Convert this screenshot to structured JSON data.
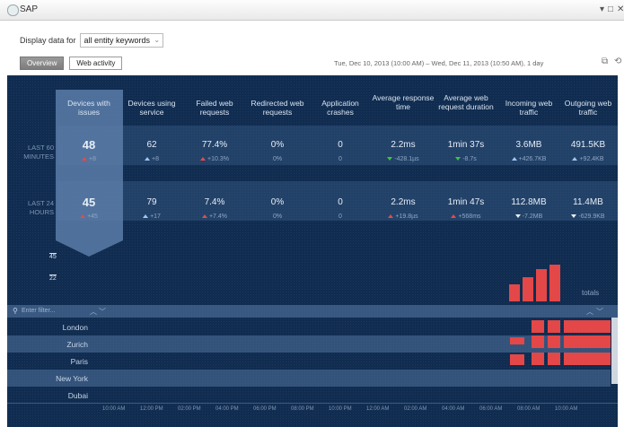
{
  "window": {
    "title": "SAP",
    "controls": {
      "minimize": "▾",
      "maximize": "□",
      "close": "✕"
    }
  },
  "display": {
    "label": "Display data for",
    "select_value": "all entity keywords"
  },
  "tabs": [
    {
      "label": "Overview"
    },
    {
      "label": "Web activity"
    }
  ],
  "date_range": "Tue, Dec 10, 2013 (10:00 AM) – Wed, Dec 11, 2013 (10:50 AM), 1 day",
  "metrics": {
    "columns": [
      {
        "header": "Devices with issues"
      },
      {
        "header": "Devices using service"
      },
      {
        "header": "Failed web requests"
      },
      {
        "header": "Redirected web requests"
      },
      {
        "header": "Application crashes"
      },
      {
        "header": "Average response time"
      },
      {
        "header": "Average web request duration"
      },
      {
        "header": "Incoming web traffic"
      },
      {
        "header": "Outgoing web traffic"
      }
    ],
    "rows": [
      {
        "label": "LAST 60 MINUTES",
        "cells": [
          {
            "value": "48",
            "delta": "+8",
            "trend": "up-red"
          },
          {
            "value": "62",
            "delta": "+8",
            "trend": "up-blue"
          },
          {
            "value": "77.4%",
            "delta": "+10.3%",
            "trend": "up-red"
          },
          {
            "value": "0%",
            "delta": "0%",
            "trend": "none"
          },
          {
            "value": "0",
            "delta": "0",
            "trend": "none"
          },
          {
            "value": "2.2ms",
            "delta": "-428.1µs",
            "trend": "down-green"
          },
          {
            "value": "1min 37s",
            "delta": "-8.7s",
            "trend": "down-green"
          },
          {
            "value": "3.6MB",
            "delta": "+426.7KB",
            "trend": "up-blue"
          },
          {
            "value": "491.5KB",
            "delta": "+92.4KB",
            "trend": "up-blue"
          }
        ]
      },
      {
        "label": "LAST 24 HOURS",
        "cells": [
          {
            "value": "45",
            "delta": "+45",
            "trend": "up-red"
          },
          {
            "value": "79",
            "delta": "+17",
            "trend": "up-blue"
          },
          {
            "value": "7.4%",
            "delta": "+7.4%",
            "trend": "up-red"
          },
          {
            "value": "0%",
            "delta": "0%",
            "trend": "none"
          },
          {
            "value": "0",
            "delta": "0",
            "trend": "none"
          },
          {
            "value": "2.2ms",
            "delta": "+19.8µs",
            "trend": "up-red"
          },
          {
            "value": "1min 47s",
            "delta": "+568ms",
            "trend": "up-red"
          },
          {
            "value": "112.8MB",
            "delta": "-7.2MB",
            "trend": "down-white"
          },
          {
            "value": "11.4MB",
            "delta": "-629.9KB",
            "trend": "down-white"
          }
        ]
      }
    ]
  },
  "chart": {
    "scale_labels": [
      "45",
      "22"
    ],
    "totals_label": "totals",
    "totals_values": [
      22,
      30,
      40,
      45
    ],
    "filter_placeholder": "Enter filter...",
    "cities": [
      "London",
      "Zurich",
      "Paris",
      "New York",
      "Dubai"
    ],
    "time_ticks": [
      "10:00 AM",
      "12:00 PM",
      "02:00 PM",
      "04:00 PM",
      "06:00 PM",
      "08:00 PM",
      "10:00 PM",
      "12:00 AM",
      "02:00 AM",
      "04:00 AM",
      "06:00 AM",
      "08:00 AM",
      "10:00 AM"
    ],
    "accent_color": "#e34747"
  }
}
